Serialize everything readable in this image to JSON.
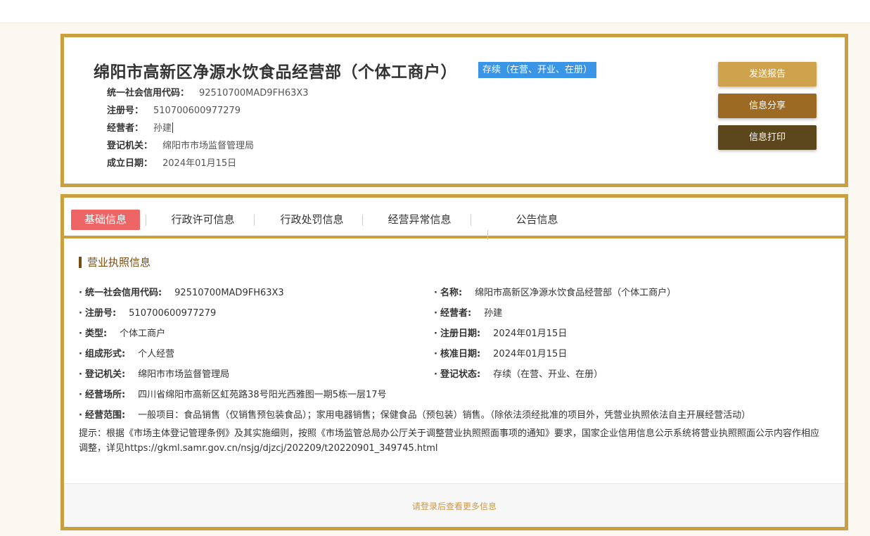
{
  "header": {
    "title": "绵阳市高新区净源水饮食品经营部（个体工商户）",
    "status": "存续（在营、开业、在册）",
    "rows": [
      {
        "label": "统一社会信用代码：",
        "value": "92510700MAD9FH63X3"
      },
      {
        "label": "注册号：",
        "value": "510700600977279"
      },
      {
        "label": "经营者：",
        "value": "孙建"
      },
      {
        "label": "登记机关：",
        "value": "绵阳市市场监督管理局"
      },
      {
        "label": "成立日期：",
        "value": "2024年01月15日"
      }
    ],
    "buttons": {
      "report": "发送报告",
      "share": "信息分享",
      "print": "信息打印"
    }
  },
  "tabs": [
    "基础信息",
    "行政许可信息",
    "行政处罚信息",
    "经营异常信息",
    "公告信息"
  ],
  "license": {
    "section_title": "营业执照信息",
    "left": [
      {
        "label": "统一社会信用代码:",
        "value": "92510700MAD9FH63X3"
      },
      {
        "label": "注册号:",
        "value": "510700600977279"
      },
      {
        "label": "类型:",
        "value": "个体工商户"
      },
      {
        "label": "组成形式:",
        "value": "个人经营"
      },
      {
        "label": "登记机关:",
        "value": "绵阳市市场监督管理局"
      }
    ],
    "right": [
      {
        "label": "名称:",
        "value": "绵阳市高新区净源水饮食品经营部（个体工商户）"
      },
      {
        "label": "经营者:",
        "value": "孙建"
      },
      {
        "label": "注册日期:",
        "value": "2024年01月15日"
      },
      {
        "label": "核准日期:",
        "value": "2024年01月15日"
      },
      {
        "label": "登记状态:",
        "value": "存续（在营、开业、在册）"
      }
    ],
    "address": {
      "label": "经营场所:",
      "value": "四川省绵阳市高新区虹苑路38号阳光西雅图一期5栋一层17号"
    },
    "scope": {
      "label": "经营范围:",
      "value": "一般项目：食品销售（仅销售预包装食品）；家用电器销售；保健食品（预包装）销售。（除依法须经批准的项目外，凭营业执照依法自主开展经营活动）"
    },
    "notice": "提示：根据《市场主体登记管理条例》及其实施细则，按照《市场监管总局办公厅关于调整营业执照照面事项的通知》要求，国家企业信用信息公示系统将营业执照照面公示内容作相应调整，详见https://gkml.samr.gov.cn/nsjg/djzcj/202209/t20220901_349745.html"
  },
  "footer": {
    "login_more": "请登录后查看更多信息"
  }
}
